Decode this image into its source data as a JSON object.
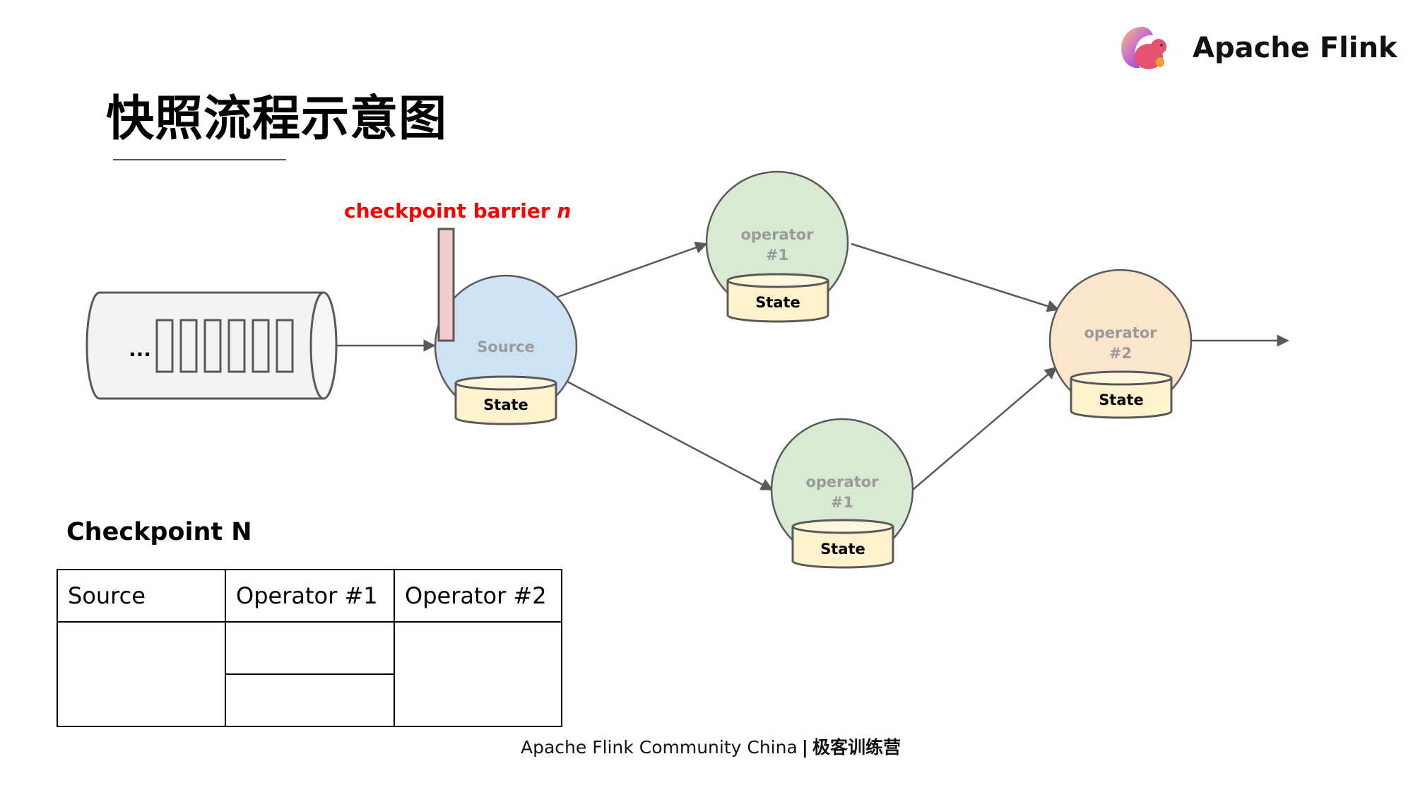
{
  "slide": {
    "title": "快照流程示意图",
    "brand": {
      "name": "Apache Flink",
      "logo_icon": "flink-squirrel-logo"
    },
    "footer": {
      "text": "Apache Flink Community China",
      "separator": "|",
      "cn_text": "极客训练营"
    }
  },
  "diagram": {
    "barrier_label": "checkpoint barrier ",
    "barrier_label_italic": "n",
    "input_stream": {
      "ellipsis": "...",
      "record_count": 6
    },
    "nodes": {
      "source": {
        "label": "Source",
        "state": "State",
        "color": "#cfe2f3"
      },
      "op1_top": {
        "label_line1": "operator",
        "label_line2": "#1",
        "state": "State",
        "color": "#d9ead3"
      },
      "op1_bottom": {
        "label_line1": "operator",
        "label_line2": "#1",
        "state": "State",
        "color": "#d9ead3"
      },
      "op2": {
        "label_line1": "operator",
        "label_line2": "#2",
        "state": "State",
        "color": "#fce5cd"
      }
    },
    "colors": {
      "state_fill": "#fff2cc",
      "barrier_fill": "#f4cccc",
      "stroke": "#595959",
      "stream_fill": "#f3f3f3",
      "barrier_text": "#ff0000"
    }
  },
  "checkpoint": {
    "heading": "Checkpoint N",
    "columns": [
      "Source",
      "Operator #1",
      "Operator #2"
    ]
  }
}
